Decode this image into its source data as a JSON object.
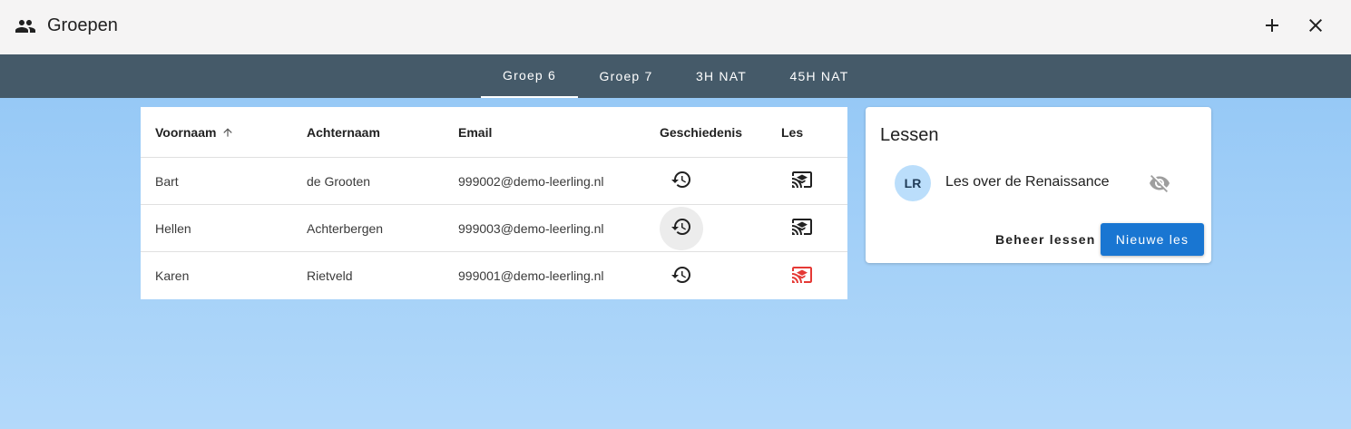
{
  "header": {
    "title": "Groepen",
    "app_icon": "group-icon",
    "add_icon": "plus-icon",
    "close_icon": "close-icon"
  },
  "tabs": [
    {
      "label": "Groep 6",
      "active": true
    },
    {
      "label": "Groep 7",
      "active": false
    },
    {
      "label": "3H NAT",
      "active": false
    },
    {
      "label": "45H NAT",
      "active": false
    }
  ],
  "table": {
    "columns": [
      "Voornaam",
      "Achternaam",
      "Email",
      "Geschiedenis",
      "Les"
    ],
    "sort_icon": "arrow-up-icon",
    "rows": [
      {
        "firstname": "Bart",
        "lastname": "de Grooten",
        "email": "999002@demo-leerling.nl",
        "lesson_status": "default"
      },
      {
        "firstname": "Hellen",
        "lastname": "Achterbergen",
        "email": "999003@demo-leerling.nl",
        "lesson_status": "default"
      },
      {
        "firstname": "Karen",
        "lastname": "Rietveld",
        "email": "999001@demo-leerling.nl",
        "lesson_status": "inactive"
      }
    ]
  },
  "lessons": {
    "title": "Lessen",
    "items": [
      {
        "initials": "LR",
        "name": "Les over de Renaissance",
        "visibility_icon": "eye-off-icon"
      }
    ],
    "manage_label": "Beheer lessen",
    "new_label": "Nieuwe les"
  },
  "colors": {
    "header_bg": "#f5f4f4",
    "tabbar_bg": "#455a69",
    "primary": "#1976d2",
    "avatar_bg": "#bbdefb",
    "inactive_red": "#e53935",
    "bg_top": "#8ec4f5",
    "bg_bottom": "#b3d9fa"
  }
}
